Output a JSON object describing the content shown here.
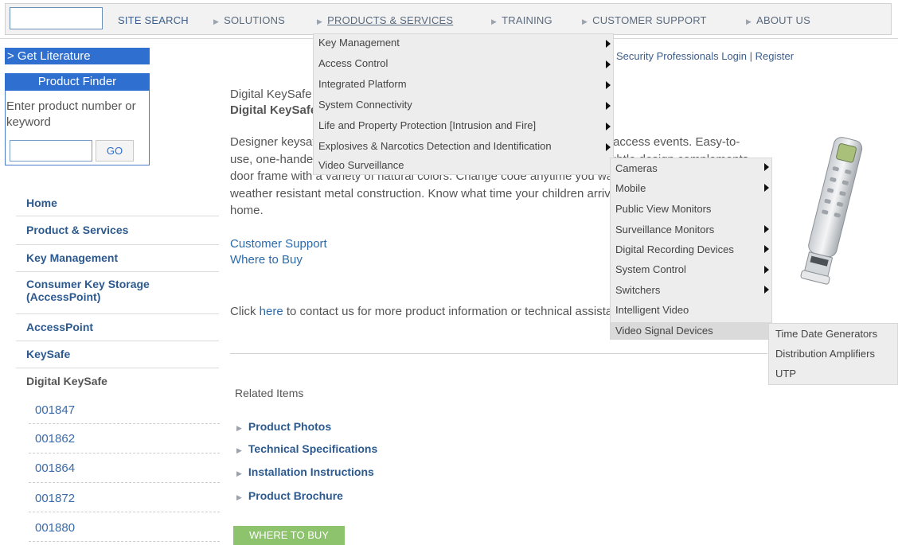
{
  "nav": {
    "site_search": "SITE SEARCH",
    "items": [
      "SOLUTIONS",
      "PRODUCTS & SERVICES",
      "TRAINING",
      "CUSTOMER SUPPORT",
      "ABOUT US"
    ]
  },
  "login": {
    "login_text": "Security Professionals Login",
    "separator": "|",
    "register": "Register"
  },
  "left": {
    "get_literature": "> Get Literature",
    "product_finder": {
      "title": "Product Finder",
      "label": "Enter product number or keyword",
      "go": "GO"
    },
    "nav": [
      "Home",
      "Product & Services",
      "Key Management",
      "Consumer Key Storage (AccessPoint)",
      "AccessPoint",
      "KeySafe",
      "Digital KeySafe"
    ],
    "sub": [
      "001847",
      "001862",
      "001864",
      "001872",
      "001880"
    ]
  },
  "main": {
    "breadcrumb": "Digital KeySafe",
    "title": "Digital KeySafe",
    "desc": [
      "Designer keysafe with an electronic combination that lets you determine access events. Easy-to-",
      "use, one-handed keypad features lighted buttons. Sleek, compact and subtle design complements",
      "door frame with a variety of natural colors. Change code anytime you want. Durable, hardened,",
      "weather resistant metal construction. Know what time your children arrive home or your",
      "home."
    ],
    "customer_support": "Customer Support",
    "where_to_buy": "Where to Buy",
    "contact_pre": "Click ",
    "contact_link": "here",
    "contact_post": " to contact us for more product information or technical assistance.",
    "related_title": "Related Items",
    "related": [
      "Product Photos",
      "Technical Specifications",
      "Installation Instructions",
      "Product Brochure"
    ],
    "where_button": "WHERE TO BUY"
  },
  "menus": {
    "products": [
      "Key Management",
      "Access Control",
      "Integrated Platform",
      "System Connectivity",
      "Life and Property Protection [Intrusion and Fire]",
      "Explosives & Narcotics Detection and Identification",
      "Video Surveillance"
    ],
    "video": [
      "Cameras",
      "Mobile",
      "Public View Monitors",
      "Surveillance Monitors",
      "Digital Recording Devices",
      "System Control",
      "Switchers",
      "Intelligent Video",
      "Video Signal Devices"
    ],
    "signal": [
      "Time Date Generators",
      "Distribution Amplifiers",
      "UTP"
    ]
  },
  "colors": {
    "accent_blue": "#2f6fd0",
    "link_blue": "#2c5a8f",
    "button_green": "#8cc36c"
  }
}
